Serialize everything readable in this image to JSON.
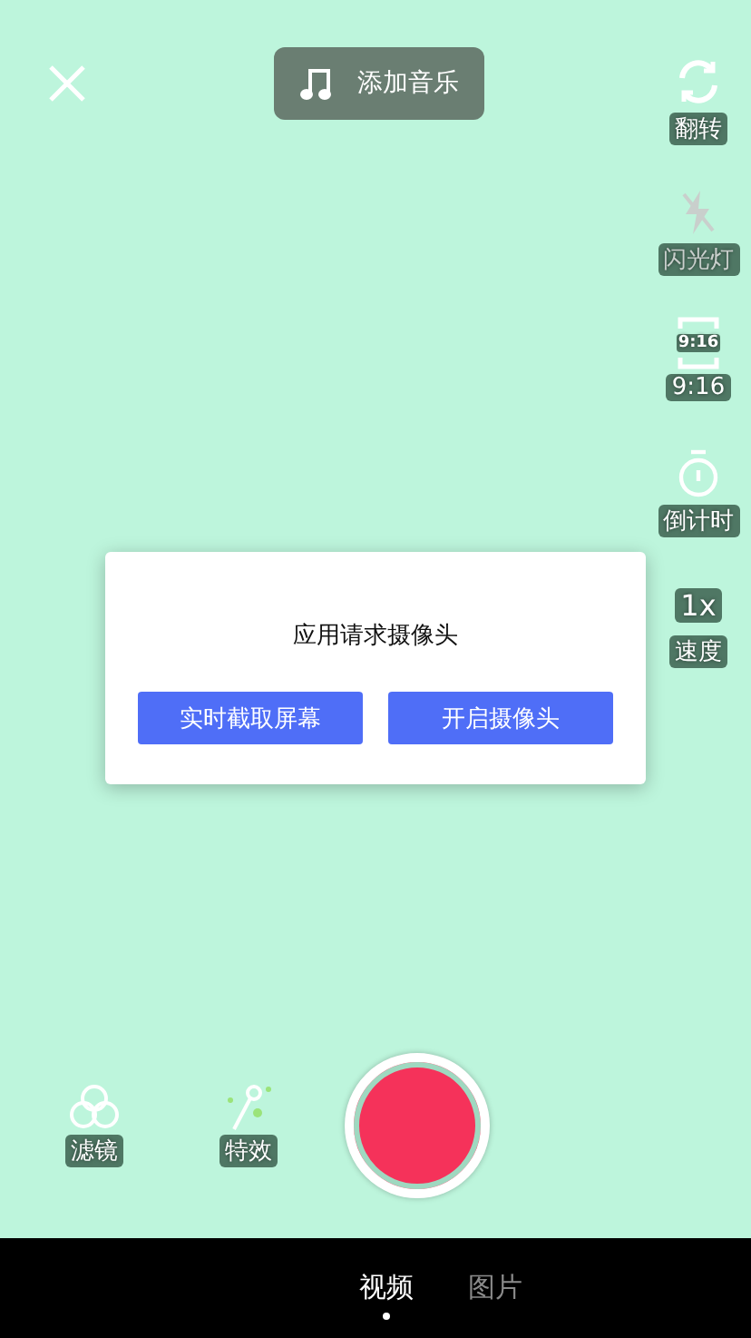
{
  "music_button": {
    "label": "添加音乐"
  },
  "tools": [
    {
      "kind": "flip",
      "label": "翻转",
      "disabled": false
    },
    {
      "kind": "flash",
      "label": "闪光灯",
      "disabled": true
    },
    {
      "kind": "ratio",
      "label": "9:16",
      "icon_text": "9:16",
      "disabled": false
    },
    {
      "kind": "timer",
      "label": "倒计时",
      "disabled": false
    },
    {
      "kind": "speed",
      "label": "速度",
      "icon_text": "1x",
      "disabled": false
    }
  ],
  "dialog": {
    "title": "应用请求摄像头",
    "buttons": [
      "实时截取屏幕",
      "开启摄像头"
    ]
  },
  "controls": [
    {
      "kind": "filter",
      "label": "滤镜"
    },
    {
      "kind": "effects",
      "label": "特效"
    }
  ],
  "modes": [
    {
      "label": "视频",
      "selected": true
    },
    {
      "label": "图片",
      "selected": false
    }
  ]
}
